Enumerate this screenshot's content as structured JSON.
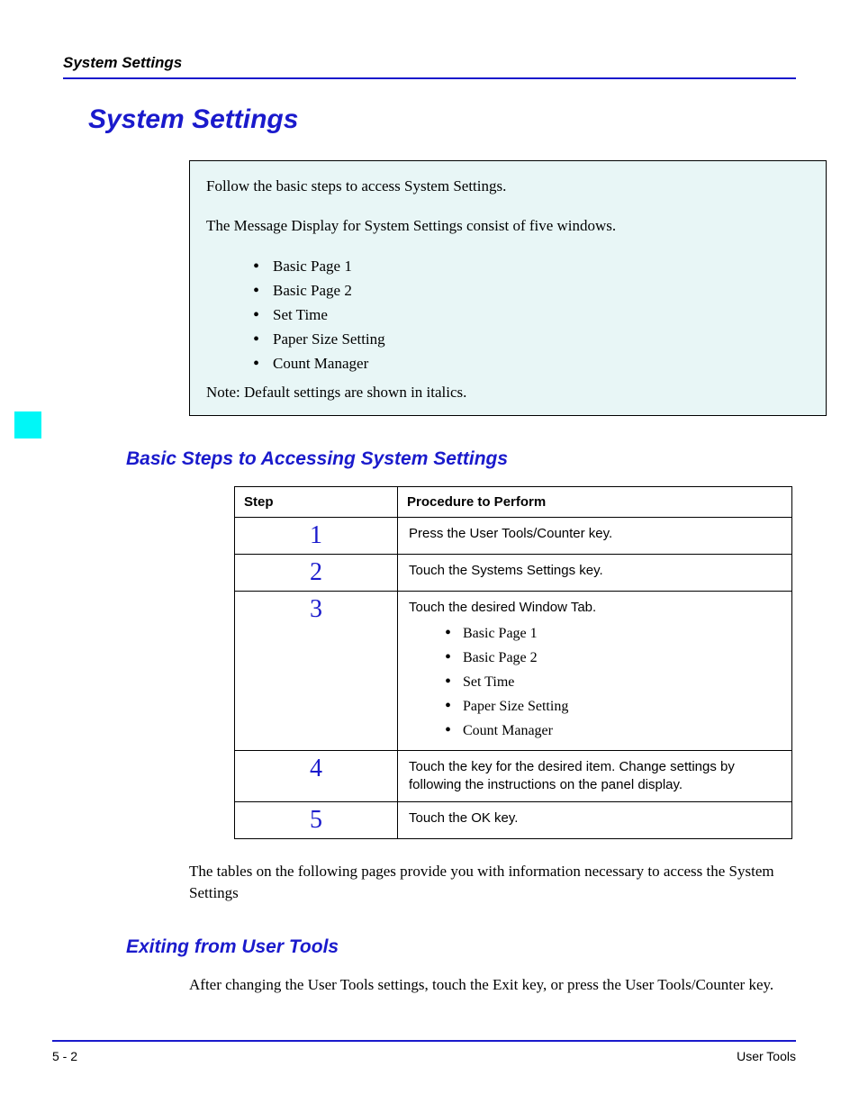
{
  "running_head": "System Settings",
  "title": "System Settings",
  "intro": {
    "p1": "Follow the basic steps to access System Settings.",
    "p2": "The Message Display for System Settings consist of five windows.",
    "items": [
      "Basic Page 1",
      "Basic Page 2",
      "Set Time",
      "Paper Size Setting",
      "Count Manager"
    ],
    "note": "Note: Default settings are shown in italics."
  },
  "section_basic_steps": "Basic Steps to Accessing System Settings",
  "table": {
    "head_step": "Step",
    "head_proc": "Procedure to Perform",
    "rows": [
      {
        "num": "1",
        "proc": "Press the User Tools/Counter key."
      },
      {
        "num": "2",
        "proc": "Touch the Systems Settings key."
      },
      {
        "num": "3",
        "proc": "Touch the desired Window Tab.",
        "list": [
          "Basic Page 1",
          "Basic Page 2",
          "Set Time",
          "Paper Size Setting",
          "Count Manager"
        ]
      },
      {
        "num": "4",
        "proc": "Touch the key for the desired item. Change settings by following the instructions on the panel display."
      },
      {
        "num": "5",
        "proc": "Touch the OK key."
      }
    ]
  },
  "para_after_table": "The tables on the following pages provide you with information necessary to access the System Settings",
  "section_exiting": "Exiting from User Tools",
  "exiting_para": "After changing the User Tools settings, touch the Exit key, or press the User Tools/Counter key.",
  "footer_left": "5 - 2",
  "footer_right": "User Tools"
}
